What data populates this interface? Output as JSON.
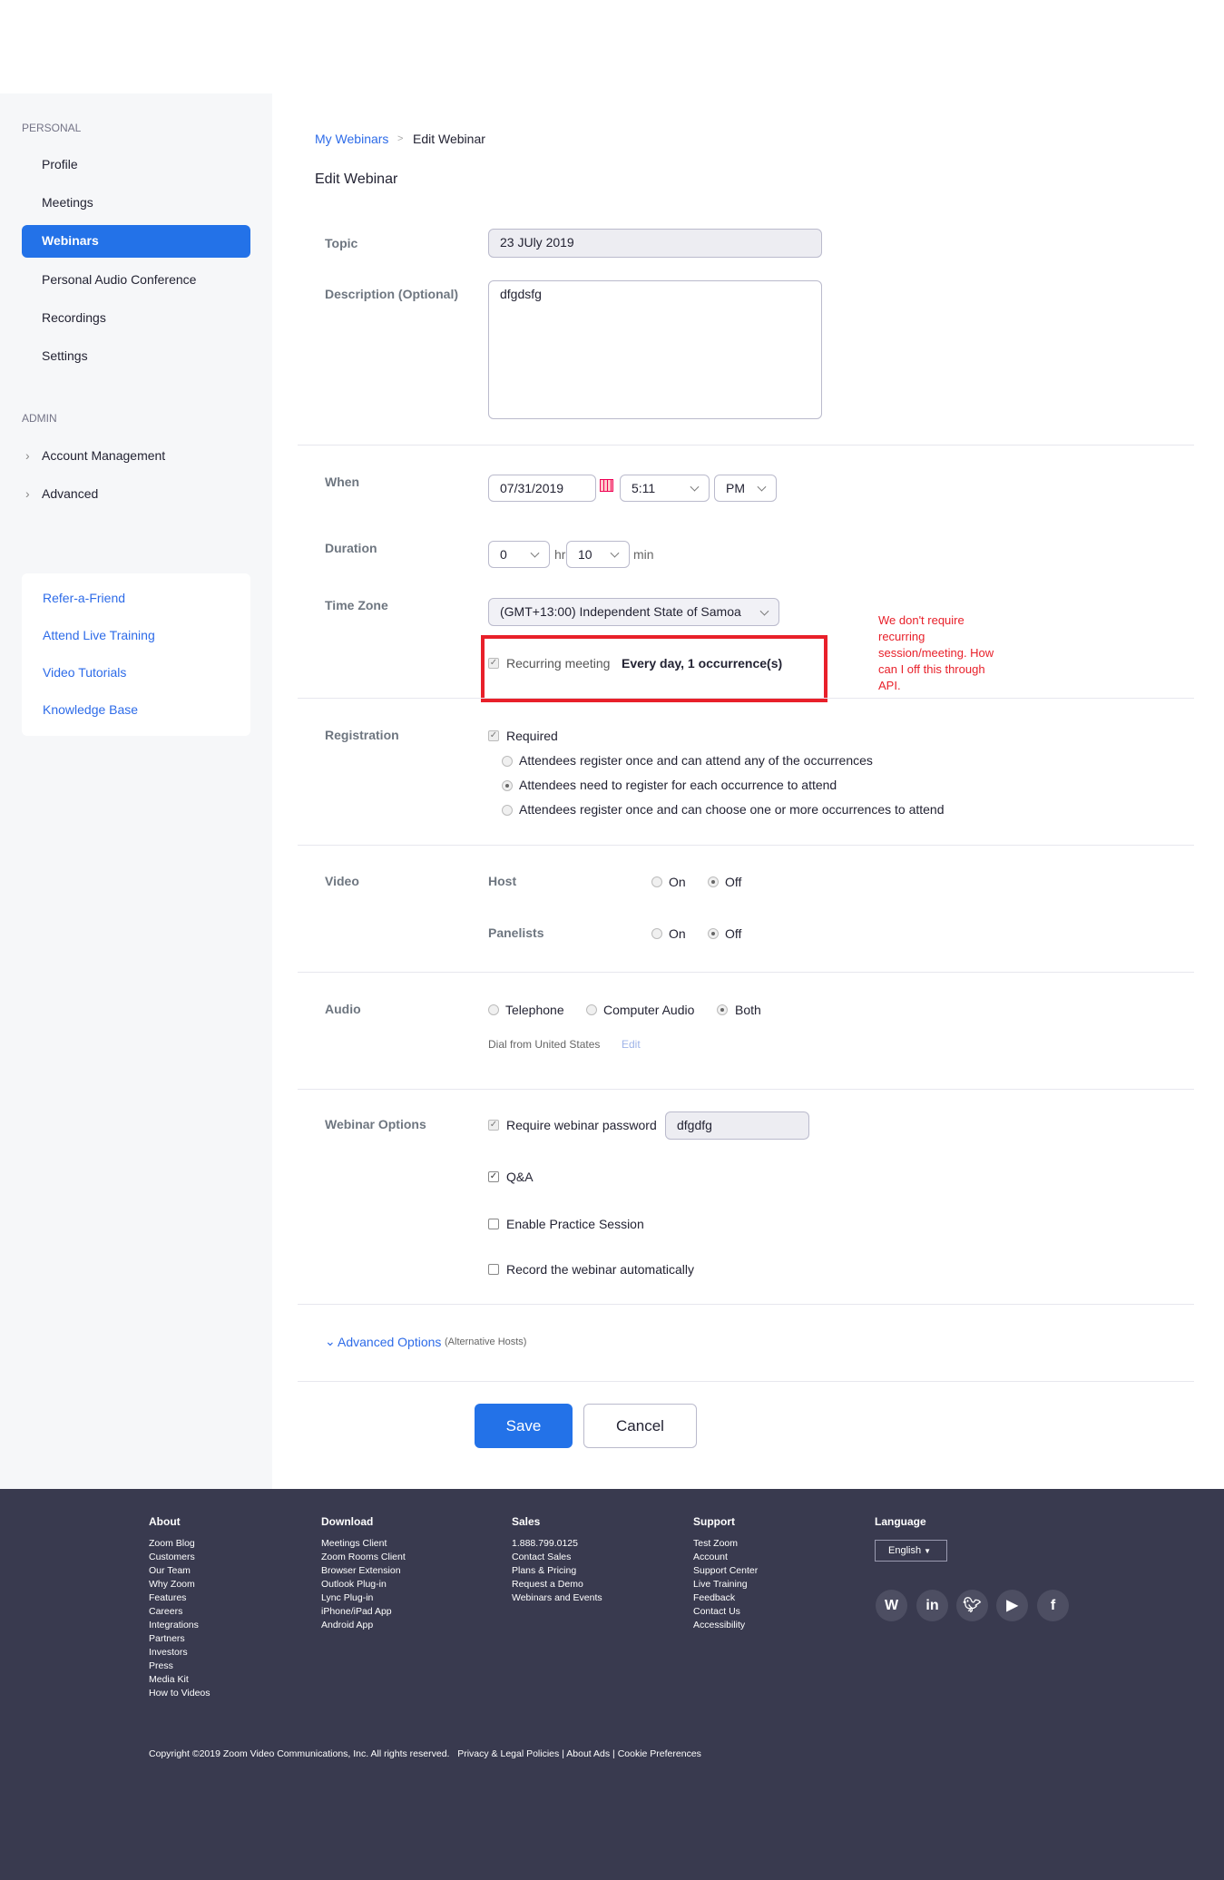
{
  "sidebar": {
    "personal_label": "PERSONAL",
    "items": [
      "Profile",
      "Meetings",
      "Webinars",
      "Personal Audio Conference",
      "Recordings",
      "Settings"
    ],
    "admin_label": "ADMIN",
    "admin_items": [
      "Account Management",
      "Advanced"
    ],
    "links": [
      "Refer-a-Friend",
      "Attend Live Training",
      "Video Tutorials",
      "Knowledge Base"
    ]
  },
  "breadcrumb": {
    "parent": "My Webinars",
    "sep": ">",
    "current": "Edit Webinar"
  },
  "title": "Edit Webinar",
  "form": {
    "topic_label": "Topic",
    "topic_value": "23 JUly 2019",
    "desc_label": "Description (Optional)",
    "desc_value": "dfgdsfg",
    "when_label": "When",
    "date": "07/31/2019",
    "time": "5:11",
    "ampm": "PM",
    "duration_label": "Duration",
    "hours": "0",
    "hr": "hr",
    "minutes": "10",
    "min": "min",
    "tz_label": "Time Zone",
    "tz": "(GMT+13:00) Independent State of Samoa",
    "recurring_label": "Recurring meeting",
    "recurring_value": "Every day, 1 occurrence(s)",
    "annotation": "We don't require recurring session/meeting. How can I off this through API.",
    "reg_label": "Registration",
    "required": "Required",
    "reg_options": [
      "Attendees register once and can attend any of the occurrences",
      "Attendees need to register for each occurrence to attend",
      "Attendees register once and can choose one or more occurrences to attend"
    ],
    "video_label": "Video",
    "host": "Host",
    "panelists": "Panelists",
    "on": "On",
    "off": "Off",
    "audio_label": "Audio",
    "audio_options": [
      "Telephone",
      "Computer Audio",
      "Both"
    ],
    "dial_from": "Dial from United States",
    "edit": "Edit",
    "options_label": "Webinar Options",
    "require_password": "Require webinar password",
    "password": "dfgdfg",
    "qa": "Q&A",
    "practice": "Enable Practice Session",
    "record": "Record the webinar automatically",
    "advanced": "Advanced Options",
    "advanced_sub": "(Alternative Hosts)",
    "save": "Save",
    "cancel": "Cancel"
  },
  "footer": {
    "about": {
      "title": "About",
      "items": [
        "Zoom Blog",
        "Customers",
        "Our Team",
        "Why Zoom",
        "Features",
        "Careers",
        "Integrations",
        "Partners",
        "Investors",
        "Press",
        "Media Kit",
        "How to Videos"
      ]
    },
    "download": {
      "title": "Download",
      "items": [
        "Meetings Client",
        "Zoom Rooms Client",
        "Browser Extension",
        "Outlook Plug-in",
        "Lync Plug-in",
        "iPhone/iPad App",
        "Android App"
      ]
    },
    "sales": {
      "title": "Sales",
      "items": [
        "1.888.799.0125",
        "Contact Sales",
        "Plans & Pricing",
        "Request a Demo",
        "Webinars and Events"
      ]
    },
    "support": {
      "title": "Support",
      "items": [
        "Test Zoom",
        "Account",
        "Support Center",
        "Live Training",
        "Feedback",
        "Contact Us",
        "Accessibility"
      ]
    },
    "language": {
      "title": "Language",
      "value": "English"
    },
    "copyright": "Copyright ©2019 Zoom Video Communications, Inc. All rights reserved.",
    "legal": [
      "Privacy & Legal Policies",
      "About Ads",
      "Cookie Preferences"
    ]
  },
  "colors": {
    "accent": "#2372e8",
    "footer": "#393a4f",
    "annotation": "#e8202a"
  }
}
